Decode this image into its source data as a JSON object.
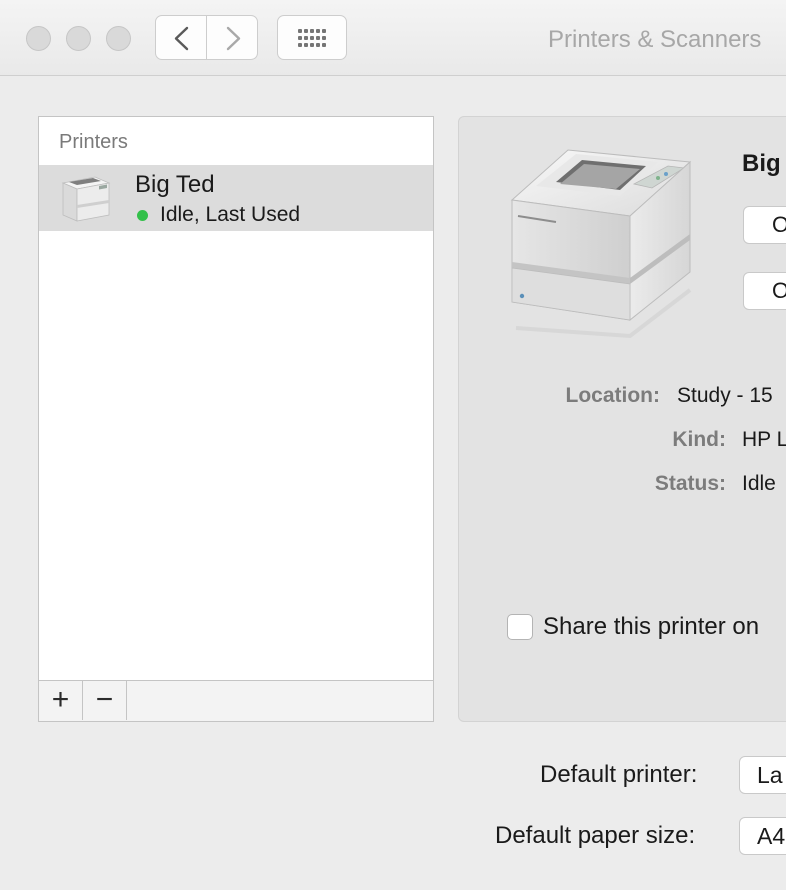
{
  "window": {
    "title": "Printers & Scanners"
  },
  "toolbar": {
    "back_icon": "chevron-left-icon",
    "forward_icon": "chevron-right-icon",
    "show_all_icon": "grid-icon"
  },
  "printers_list": {
    "header": "Printers",
    "items": [
      {
        "name": "Big Ted",
        "status": "Idle, Last Used",
        "status_color": "#33c04a",
        "icon": "printer-icon"
      }
    ],
    "add_label": "+",
    "remove_label": "−"
  },
  "detail": {
    "name": "Big",
    "button_1_label": "O",
    "button_2_label": "O",
    "location_label": "Location:",
    "location_value": "Study - 15",
    "kind_label": "Kind:",
    "kind_value": "HP L",
    "status_label": "Status:",
    "status_value": "Idle",
    "share_label": "Share this printer on",
    "share_checked": false
  },
  "defaults": {
    "printer_label": "Default printer:",
    "printer_value": "La",
    "paper_label": "Default paper size:",
    "paper_value": "A4"
  }
}
